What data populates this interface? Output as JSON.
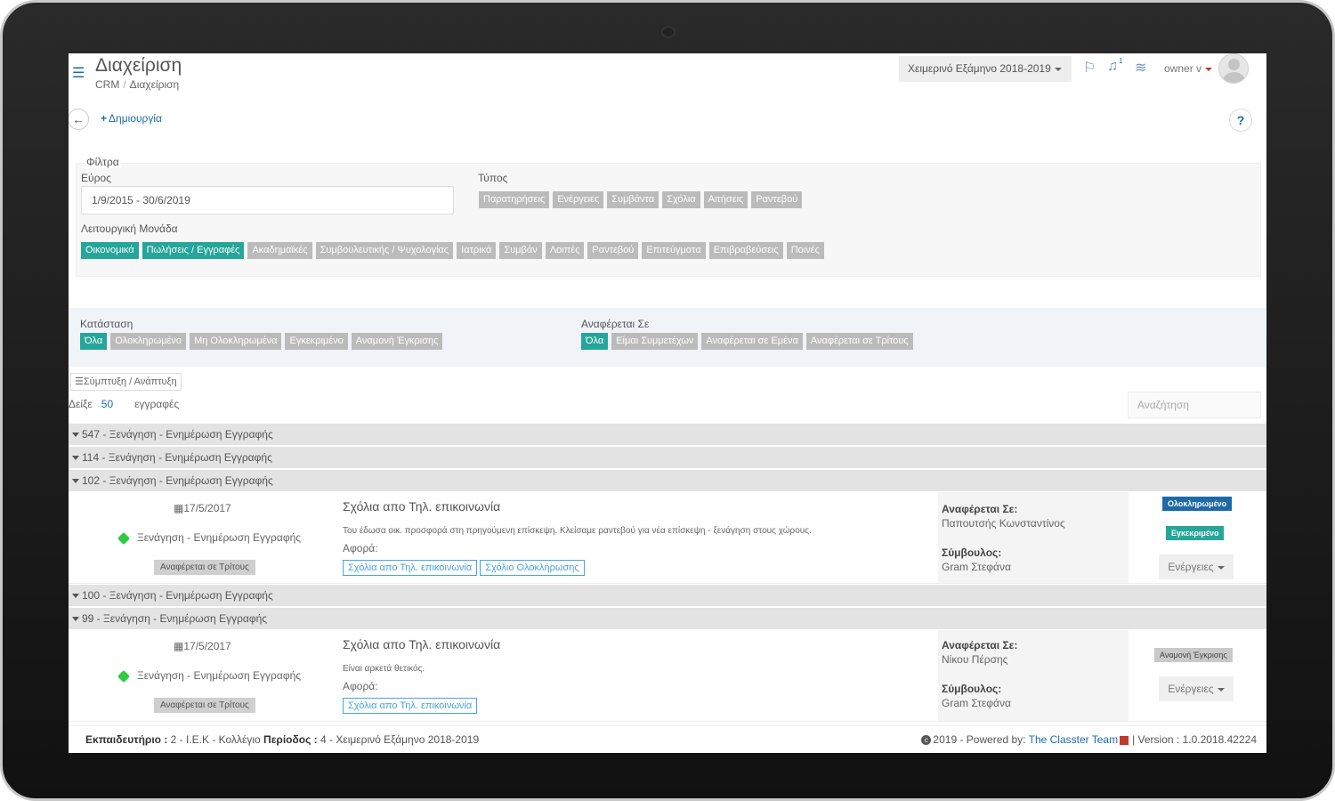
{
  "header": {
    "title": "Διαχείριση",
    "breadcrumbs": [
      "CRM",
      "Διαχείριση"
    ],
    "semester": "Χειμερινό Εξάμηνο 2018-2019",
    "notification_count": "1",
    "user": "owner v",
    "icons": [
      "menu-icon",
      "flag-icon",
      "bell-icon",
      "layers-icon"
    ]
  },
  "toolbar": {
    "create_label": "Δημιουργία",
    "help_label": "?"
  },
  "filters": {
    "legend": "Φίλτρα",
    "range_label": "Εύρος",
    "range_value": "1/9/2015 - 30/6/2019",
    "type_label": "Τύπος",
    "types": [
      "Παρατηρήσεις",
      "Ενέργειες",
      "Συμβάντα",
      "Σχόλια",
      "Αιτήσεις",
      "Ραντεβού"
    ],
    "unit_label": "Λειτουργική Μονάδα",
    "units": [
      "Οικονομικά",
      "Πωλήσεις / Εγγραφές",
      "Ακαδημαϊκές",
      "Συμβουλευτικής / Ψυχολογίας",
      "Ιατρικά",
      "Συμβάν",
      "Λοιπές",
      "Ραντεβού",
      "Επιτεύγματα",
      "Επιβραβεύσεις",
      "Ποινές"
    ],
    "status_label": "Κατάσταση",
    "statuses": [
      "Όλα",
      "Ολοκληρωμένο",
      "Μη Ολοκληρωμένα",
      "Εγκεκριμένο",
      "Αναμονή Έγκρισης"
    ],
    "refers_label": "Αναφέρεται Σε",
    "refers": [
      "Όλα",
      "Είμαι Συμμετέχων",
      "Αναφέρεται σε Εμένα",
      "Αναφέρεται σε Τρίτους"
    ]
  },
  "list": {
    "collapse_label": "Σύμπτυξη / Ανάπτυξη",
    "show_prefix": "Δείξε",
    "show_count": "50",
    "show_suffix": "εγγραφές",
    "search_placeholder": "Αναζήτηση",
    "groups": [
      "547 - Ξενάγηση - Ενημέρωση Εγγραφής",
      "114 - Ξενάγηση - Ενημέρωση Εγγραφής",
      "102 - Ξενάγηση - Ενημέρωση Εγγραφής",
      "100 - Ξενάγηση - Ενημέρωση Εγγραφής",
      "99 - Ξενάγηση - Ενημέρωση Εγγραφής"
    ],
    "records": [
      {
        "date": "17/5/2017",
        "category": "Ξενάγηση - Ενημέρωση Εγγραφής",
        "ref": "Αναφέρεται σε Τρίτους",
        "title": "Σχόλια απο Τηλ. επικοινωνία",
        "description": "Του έδωσα οικ. προσφορά στη πρηγούμενη επίσκεψη. Κλείσαμε ραντεβού για νέα επίσκεψη - ξενάγηση στους χώρους.",
        "about_label": "Αφορά:",
        "links": [
          "Σχόλια απο Τηλ. επικοινωνία",
          "Σχόλιο Ολοκλήρωσης"
        ],
        "refers_label": "Αναφέρεται Σε:",
        "refers_value": "Παπουτσής Κωνσταντίνος",
        "advisor_label": "Σύμβουλος:",
        "advisor_value": "Gram Στεφάνα",
        "status1": "Ολοκληρωμένο",
        "status2": "Εγκεκριμένο",
        "actions": "Ενέργειες"
      },
      {
        "date": "17/5/2017",
        "category": "Ξενάγηση - Ενημέρωση Εγγραφής",
        "ref": "Αναφέρεται σε Τρίτους",
        "title": "Σχόλια απο Τηλ. επικοινωνία",
        "description": "Είναι αρκετά θετικός.",
        "about_label": "Αφορά:",
        "links": [
          "Σχόλια απο Τηλ. επικοινωνία"
        ],
        "refers_label": "Αναφέρεται Σε:",
        "refers_value": "Νίκου Πέρσης",
        "advisor_label": "Σύμβουλος:",
        "advisor_value": "Gram Στεφάνα",
        "status1": "Αναμονή Έγκρισης",
        "actions": "Ενέργειες"
      }
    ]
  },
  "footer": {
    "school_label": "Εκπαιδευτήριο :",
    "school_value": "2 - Ι.Ε.Κ - Κολλέγιο",
    "period_label": "Περίοδος :",
    "period_value": "4 - Χειμερινό Εξάμηνο 2018-2019",
    "copyright": "2019 - Powered by:",
    "team": "The Classter Team",
    "version": "| Version : 1.0.2018.42224"
  },
  "colors": {
    "accent": "#1e6aa8",
    "active_chip": "#26a69a",
    "inactive_chip": "#bbbbbb"
  }
}
